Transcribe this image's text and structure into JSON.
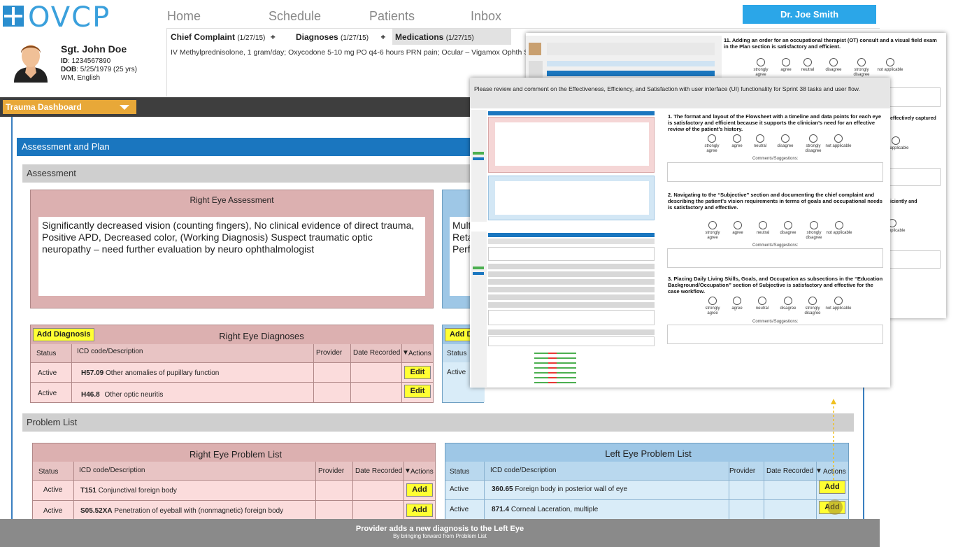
{
  "app": {
    "logo_text": "OVCP"
  },
  "nav": [
    "Home",
    "Schedule",
    "Patients",
    "Inbox"
  ],
  "user": {
    "name": "Dr. Joe Smith"
  },
  "patient": {
    "name": "Sgt. John Doe",
    "id_label": "ID",
    "id_value": ": 1234567890",
    "dob_label": "DOB",
    "dob_value": ": 5/25/1979 (25 yrs)",
    "demo": "WM, English"
  },
  "patient_tabs": {
    "chief_complaint": "Chief Complaint",
    "chief_complaint_date": "(1/27/15)",
    "diagnoses": "Diagnoses",
    "diagnoses_date": "(1/27/15)",
    "medications": "Medications",
    "medications_date": "(1/27/15)",
    "plus": "+"
  },
  "medications_line": "IV Methylprednisolone, 1 gram/day; Oxycodone 5-10 mg PO q4-6 hours PRN pain; Ocular – Vigamox Ophth S",
  "dashboard": {
    "selector": "Trauma Dashboard"
  },
  "sections": {
    "assessment_and_plan": "Assessment and Plan",
    "assessment": "Assessment",
    "problem_list": "Problem List"
  },
  "right_eye_assessment": {
    "title": "Right Eye Assessment",
    "text": "Significantly decreased vision (counting fingers), No clinical evidence of direct trauma, Positive APD, Decreased color, (Working Diagnosis) Suspect traumatic optic neuropathy – need further evaluation by neuro ophthalmologist"
  },
  "left_eye_assessment_partial": [
    "Mult",
    "Reta",
    "Perf"
  ],
  "right_eye_diagnoses": {
    "title": "Right Eye Diagnoses",
    "add_label": "Add Diagnosis",
    "columns": [
      "Status",
      "ICD code/Description",
      "Provider",
      "Date Recorded ▼",
      "Actions"
    ],
    "rows": [
      {
        "status": "Active",
        "code": "H57.09",
        "desc": "Other anomalies of pupillary function",
        "action": "Edit"
      },
      {
        "status": "Active",
        "code": "H46.8",
        "desc": "Other optic neuritis",
        "action": "Edit"
      }
    ]
  },
  "left_eye_diagnoses_partial": {
    "add_label": "Add D",
    "status_col": "Status",
    "row_status": "Active"
  },
  "right_eye_problems": {
    "title": "Right Eye Problem List",
    "columns": [
      "Status",
      "ICD code/Description",
      "Provider",
      "Date Recorded ▼",
      "Actions"
    ],
    "rows": [
      {
        "status": "Active",
        "code": "T151",
        "desc": "Conjunctival foreign body",
        "action": "Add"
      },
      {
        "status": "Active",
        "code": "S05.52XA",
        "desc": "Penetration of eyeball with (nonmagnetic) foreign body",
        "action": "Add"
      }
    ]
  },
  "left_eye_problems": {
    "title": "Left Eye Problem List",
    "columns": [
      "Status",
      "ICD code/Description",
      "Provider",
      "Date Recorded ▼",
      "Actions"
    ],
    "rows": [
      {
        "status": "Active",
        "code": "360.65",
        "desc": "Foreign body in posterior wall of eye",
        "action": "Add"
      },
      {
        "status": "Active",
        "code": "871.4",
        "desc": "Corneal Laceration, multiple",
        "action": "Add"
      }
    ]
  },
  "footer": {
    "title": "Provider adds a new diagnosis to the Left Eye",
    "subtitle": "By bringing forward from Problem List"
  },
  "survey_back": {
    "q11": "11. Adding an order for an occupational therapist (OT) consult and a visual field exam in the Plan section is satisfactory and efficient.",
    "snip1": "effectively captured",
    "snip2": "iciently and"
  },
  "survey_front": {
    "intro": "Please review and comment on the Effectiveness, Efficiency, and Satisfaction with user interface (UI) functionality for Sprint 38 tasks and user flow.",
    "q1": "1. The format and layout of the Flowsheet with a timeline and data points for each eye is satisfactory and efficient because it supports the clinician’s need for an effective review of the patient’s history.",
    "q2": "2. Navigating to the “Subjective” section and documenting the chief complaint and describing the patient’s vision requirements in terms of goals and occupational needs is satisfactory and effective.",
    "q3": "3. Placing Daily Living Skills, Goals, and Occupation as subsections in the “Education Background/Occupation” section of Subjective is satisfactory and effective for the case workflow.",
    "comments_label": "Comments/Suggestions:",
    "options": [
      "strongly agree",
      "agree",
      "neutral",
      "disagree",
      "strongly disagree",
      "not applicable"
    ]
  }
}
